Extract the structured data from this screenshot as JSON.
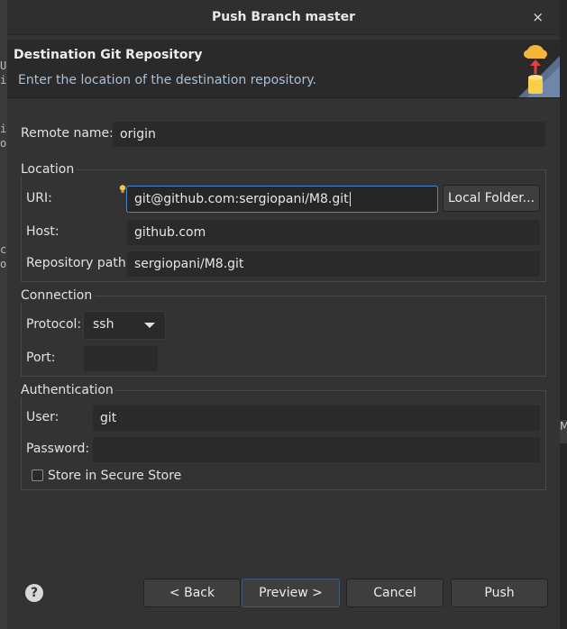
{
  "window": {
    "title": "Push Branch master",
    "close_symbol": "×"
  },
  "header": {
    "title": "Destination Git Repository",
    "description": "Enter the location of the destination repository."
  },
  "remote": {
    "label": "Remote name:",
    "value": "origin"
  },
  "location": {
    "group_label": "Location",
    "uri_label": "URI:",
    "uri_value": "git@github.com:sergiopani/M8.git",
    "local_folder_label": "Local Folder...",
    "host_label": "Host:",
    "host_value": "github.com",
    "repo_path_label": "Repository path:",
    "repo_path_value": "sergiopani/M8.git"
  },
  "connection": {
    "group_label": "Connection",
    "protocol_label": "Protocol:",
    "protocol_value": "ssh",
    "port_label": "Port:",
    "port_value": ""
  },
  "authentication": {
    "group_label": "Authentication",
    "user_label": "User:",
    "user_value": "git",
    "password_label": "Password:",
    "password_value": "",
    "store_label": "Store in Secure Store",
    "store_checked": false
  },
  "footer": {
    "help_symbol": "?",
    "back_label": "< Back",
    "preview_label": "Preview >",
    "cancel_label": "Cancel",
    "push_label": "Push"
  },
  "background": {
    "left_glyphs": [
      "U",
      "i",
      "i",
      "o",
      "c",
      "o"
    ],
    "right_tab": "M"
  },
  "colors": {
    "dialog_bg": "#333333",
    "field_bg": "#2a2a2a",
    "focus_border": "#4d86c8",
    "description_text": "#a9c0d6"
  }
}
